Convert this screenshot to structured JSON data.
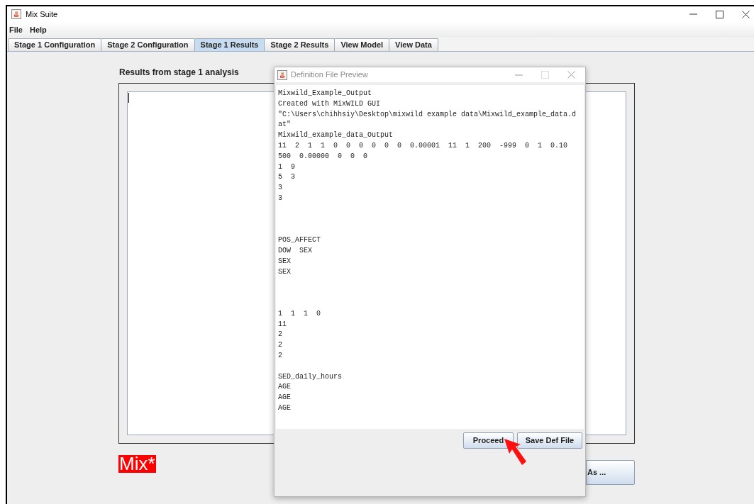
{
  "window": {
    "title": "Mix Suite"
  },
  "menu": [
    "File",
    "Help"
  ],
  "tabs": [
    {
      "label": "Stage 1 Configuration",
      "selected": false
    },
    {
      "label": "Stage 2 Configuration",
      "selected": false
    },
    {
      "label": "Stage 1 Results",
      "selected": true
    },
    {
      "label": "Stage 2 Results",
      "selected": false
    },
    {
      "label": "View Model",
      "selected": false
    },
    {
      "label": "View Data",
      "selected": false
    }
  ],
  "results": {
    "heading": "Results from stage 1 analysis",
    "logo": "Mix*",
    "button": "As ..."
  },
  "dialog": {
    "title": "Definition File Preview",
    "active": false,
    "blocks": [
      {
        "kind": "first",
        "lines": [
          "Mixwild_Example_Output",
          "Created with MixWILD GUI",
          "\"C:\\Users\\chihhsiy\\Desktop\\mixwild example data\\Mixwild_example_data.d",
          "at\"",
          "Mixwild_example_data_Output",
          "11  2  1  1  0  0  0  0  0  0  0.00001  11  1  200  -999  0  1  0.10",
          "500  0.00000  0  0  0",
          "1  9",
          "5  3",
          "3",
          "3"
        ]
      },
      {
        "kind": "widegap",
        "lines": [
          "POS_AFFECT",
          "DOW  SEX",
          "SEX",
          "SEX"
        ]
      },
      {
        "kind": "widegap",
        "lines": [
          "1  1  1  0",
          "11",
          "2",
          "2",
          "2"
        ]
      },
      {
        "kind": "narrowgap",
        "lines": [
          "SED_daily_hours",
          "AGE",
          "AGE",
          "AGE"
        ]
      }
    ],
    "buttons": [
      "Proceed",
      "Save Def File"
    ]
  }
}
